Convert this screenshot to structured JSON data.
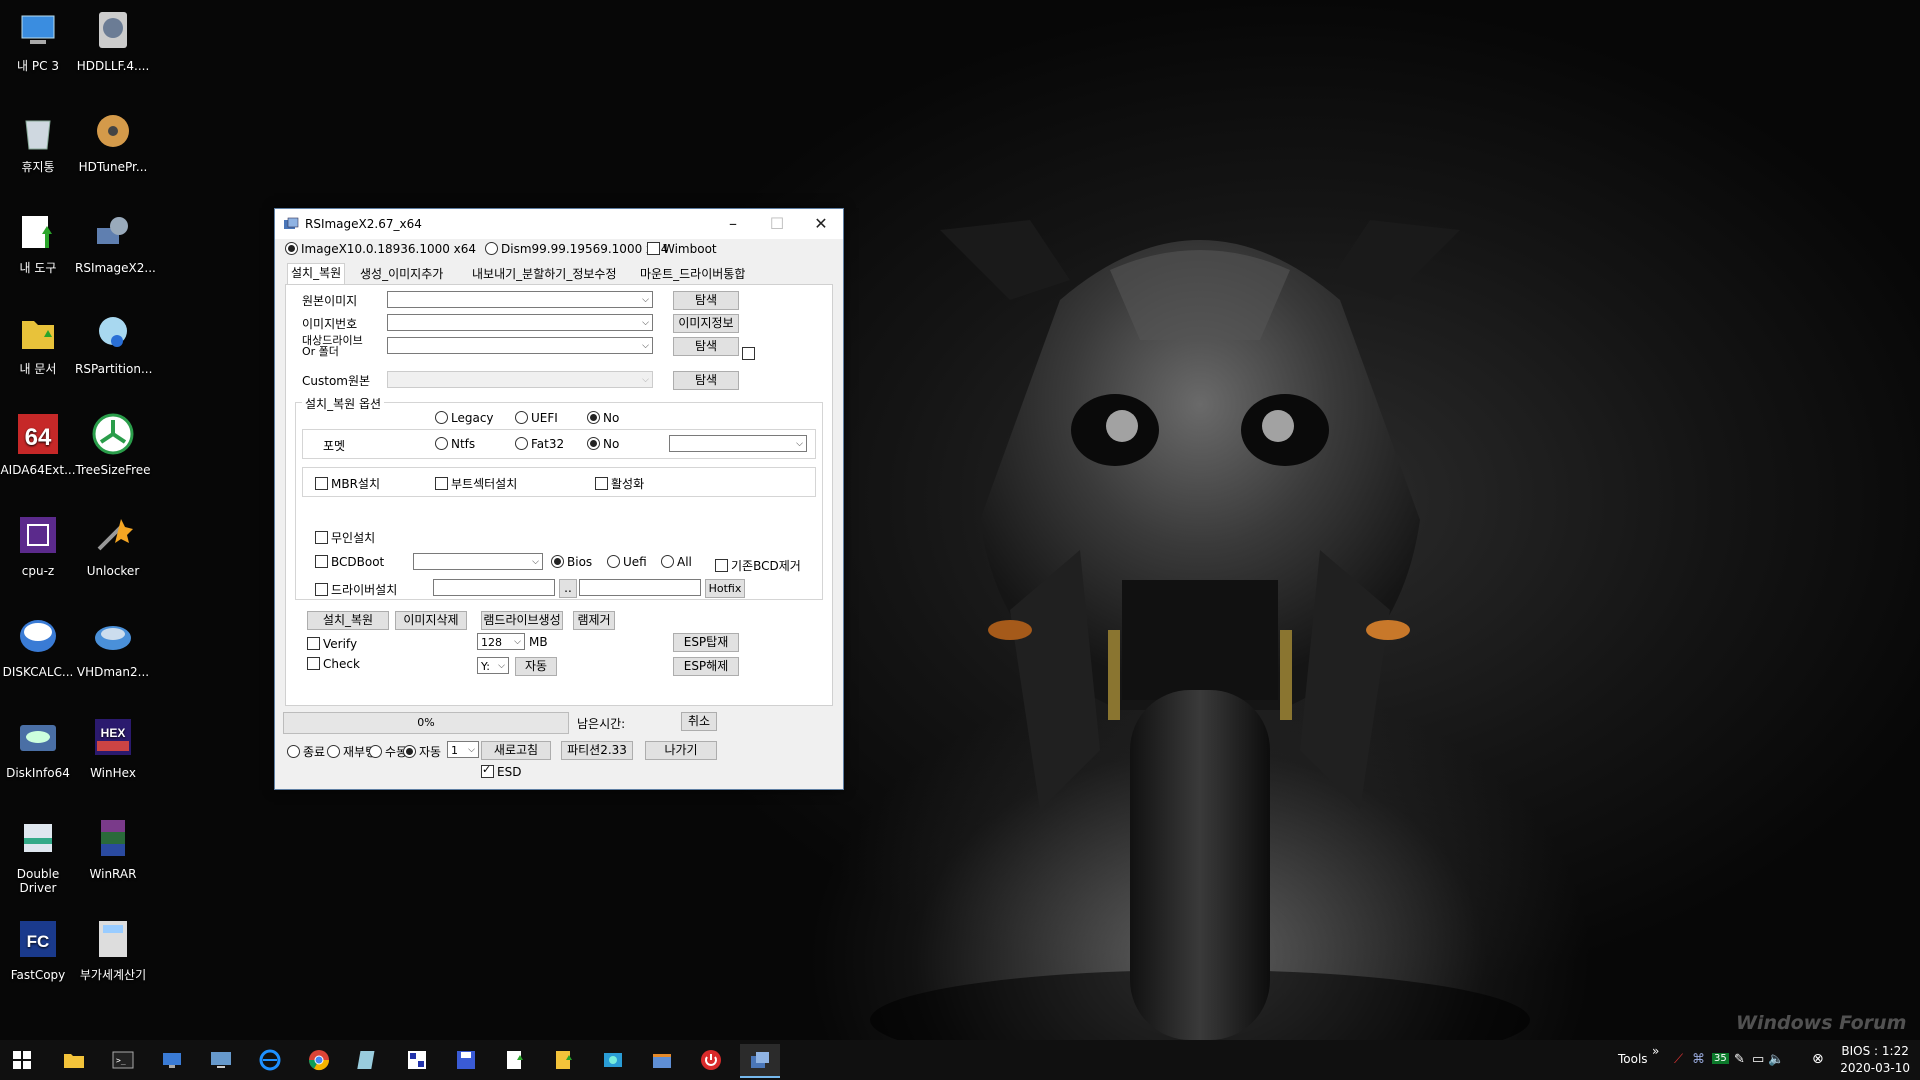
{
  "desktop": {
    "icons": [
      {
        "label": "내 PC 3",
        "icon": "computer-icon"
      },
      {
        "label": "HDDLLF.4....",
        "icon": "hdd-tool-icon"
      },
      {
        "label": "휴지통",
        "icon": "recycle-bin-icon"
      },
      {
        "label": "HDTunePr...",
        "icon": "hdtune-icon"
      },
      {
        "label": "내 도구",
        "icon": "tools-folder-icon"
      },
      {
        "label": "RSImageX2...",
        "icon": "rsimagex-icon"
      },
      {
        "label": "내 문서",
        "icon": "documents-folder-icon"
      },
      {
        "label": "RSPartition...",
        "icon": "rspartition-icon"
      },
      {
        "label": "AIDA64Ext...",
        "icon": "aida64-icon"
      },
      {
        "label": "TreeSizeFree",
        "icon": "treesize-icon"
      },
      {
        "label": "cpu-z",
        "icon": "cpuz-icon"
      },
      {
        "label": "Unlocker",
        "icon": "unlocker-icon"
      },
      {
        "label": "DISKCALC...",
        "icon": "diskcalc-icon"
      },
      {
        "label": "VHDman2...",
        "icon": "vhdman-icon"
      },
      {
        "label": "DiskInfo64",
        "icon": "diskinfo-icon"
      },
      {
        "label": "WinHex",
        "icon": "winhex-icon"
      },
      {
        "label": "Double Driver",
        "icon": "double-driver-icon"
      },
      {
        "label": "WinRAR",
        "icon": "winrar-icon"
      },
      {
        "label": "FastCopy",
        "icon": "fastcopy-icon"
      },
      {
        "label": "부가세계산기",
        "icon": "calculator-icon"
      }
    ],
    "watermark": "Windows Forum"
  },
  "window": {
    "title": "RSImageX2.67_x64",
    "engine_imagex": "ImageX10.0.18936.1000 x64",
    "engine_dism": "Dism99.99.19569.1000 x64",
    "wimboot": "Wimboot",
    "tabs": [
      "설치_복원",
      "생성_이미지추가",
      "내보내기_분할하기_정보수정",
      "마운트_드라이버통합"
    ],
    "source_image_label": "원본이미지",
    "image_index_label": "이미지번호",
    "target_drive_label_1": "대상드라이브",
    "target_drive_label_2": "Or 폴더",
    "custom_source_label": "Custom원본",
    "browse": "탐색",
    "image_info": "이미지정보",
    "options_group": "설치_복원 옵션",
    "boot_legacy": "Legacy",
    "boot_uefi": "UEFI",
    "boot_no": "No",
    "format_label": "포멧",
    "fmt_ntfs": "Ntfs",
    "fmt_fat32": "Fat32",
    "fmt_no": "No",
    "mbr": "MBR설치",
    "bootsector": "부트섹터설치",
    "activate": "활성화",
    "unattend": "무인설치",
    "bcdboot": "BCDBoot",
    "bcd_bios": "Bios",
    "bcd_uefi": "Uefi",
    "bcd_all": "All",
    "bcd_remove": "기존BCD제거",
    "driver_install": "드라이버설치",
    "dots": "..",
    "hotfix": "Hotfix",
    "btn_install": "설치_복원",
    "btn_delete": "이미지삭제",
    "btn_ramdrive": "램드라이브생성",
    "btn_ramremove": "램제거",
    "btn_esp_mount": "ESP탑재",
    "btn_esp_unmount": "ESP해제",
    "verify": "Verify",
    "check": "Check",
    "ram_size": "128",
    "ram_unit": "MB",
    "drive_letter": "Y:",
    "btn_auto": "자동",
    "progress_text": "0%",
    "progress": 0,
    "remaining_label": "남은시간:",
    "btn_cancel": "취소",
    "after_shutdown": "종료",
    "after_reboot": "재부팅",
    "after_manual": "수동",
    "after_auto": "자동",
    "count_value": "1",
    "btn_refresh": "새로고침",
    "btn_partition": "파티션2.33",
    "btn_exit": "나가기",
    "esd": "ESD"
  },
  "taskbar": {
    "items": [
      "start-icon",
      "file-explorer-icon",
      "cmd-icon",
      "monitor-icon",
      "remote-icon",
      "ie-icon",
      "chrome-icon",
      "notepad-icon",
      "qr-icon",
      "floppy-save-icon",
      "folder-green-arrow-icon",
      "doc-green-arrow-icon",
      "network-icon",
      "window-app-icon",
      "power-icon",
      "rsimagex-taskbar-icon"
    ],
    "tools_label": "Tools",
    "chevron": "»",
    "tray_number": "35",
    "clock_line1": "BIOS : 1:22",
    "clock_line2": "2020-03-10"
  }
}
